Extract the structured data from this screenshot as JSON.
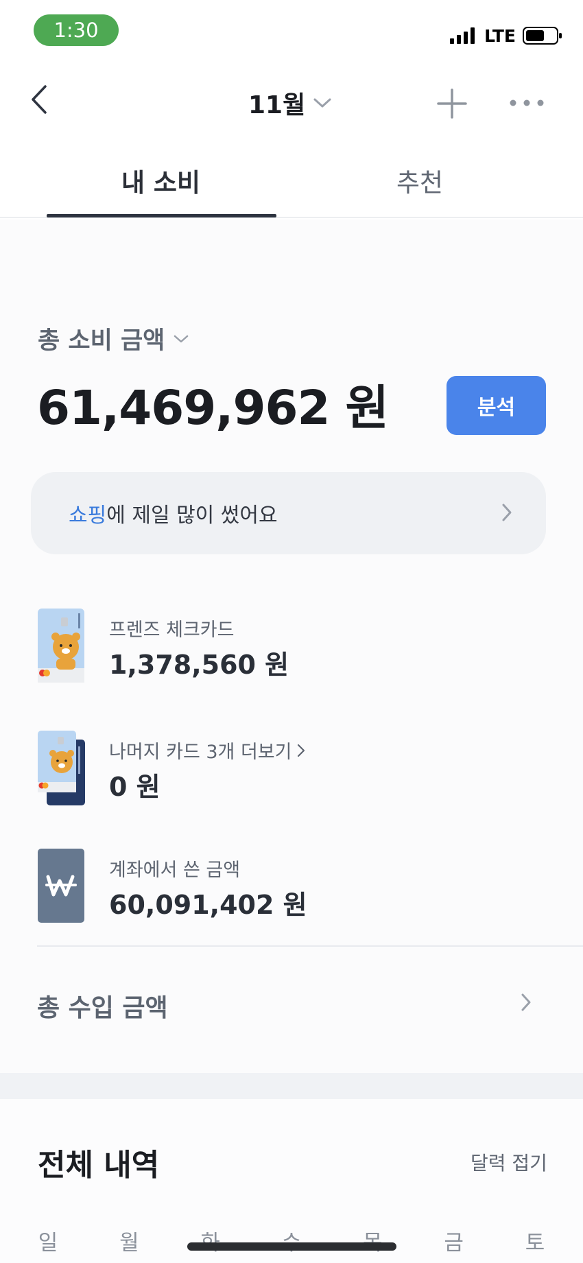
{
  "status_bar": {
    "time": "1:30",
    "network": "LTE",
    "icons": [
      "signal-icon",
      "battery-icon"
    ]
  },
  "nav": {
    "month": "11월",
    "icons": [
      "back-icon",
      "chevron-down-icon",
      "add-icon",
      "more-icon"
    ]
  },
  "tabs": [
    {
      "label": "내 소비",
      "active": true
    },
    {
      "label": "추천",
      "active": false
    }
  ],
  "summary": {
    "label": "총 소비 금액",
    "amount": "61,469,962 원",
    "analysis_button": "분석",
    "top_category": {
      "highlight": "쇼핑",
      "rest": "에 제일 많이 썼어요"
    }
  },
  "spending_rows": [
    {
      "title": "프렌즈 체크카드",
      "amount": "1,378,560 원",
      "icon": "ryan-check-card-icon"
    },
    {
      "title": "나머지 카드 3개 더보기",
      "amount": "0 원",
      "icon": "stacked-cards-icon",
      "link": true
    },
    {
      "title": "계좌에서 쓴 금액",
      "amount": "60,091,402 원",
      "icon": "won-account-icon"
    }
  ],
  "income": {
    "label": "총 수입 금액"
  },
  "history": {
    "title": "전체 내역",
    "calendar_toggle": "달력 접기",
    "weekdays": [
      "일",
      "월",
      "화",
      "수",
      "목",
      "금",
      "토"
    ]
  },
  "colors": {
    "accent": "#4a84ea",
    "highlight": "#3a7bdc",
    "status_green": "#4ea953",
    "text_dark": "#1b1d22",
    "text_muted": "#5c6470"
  }
}
